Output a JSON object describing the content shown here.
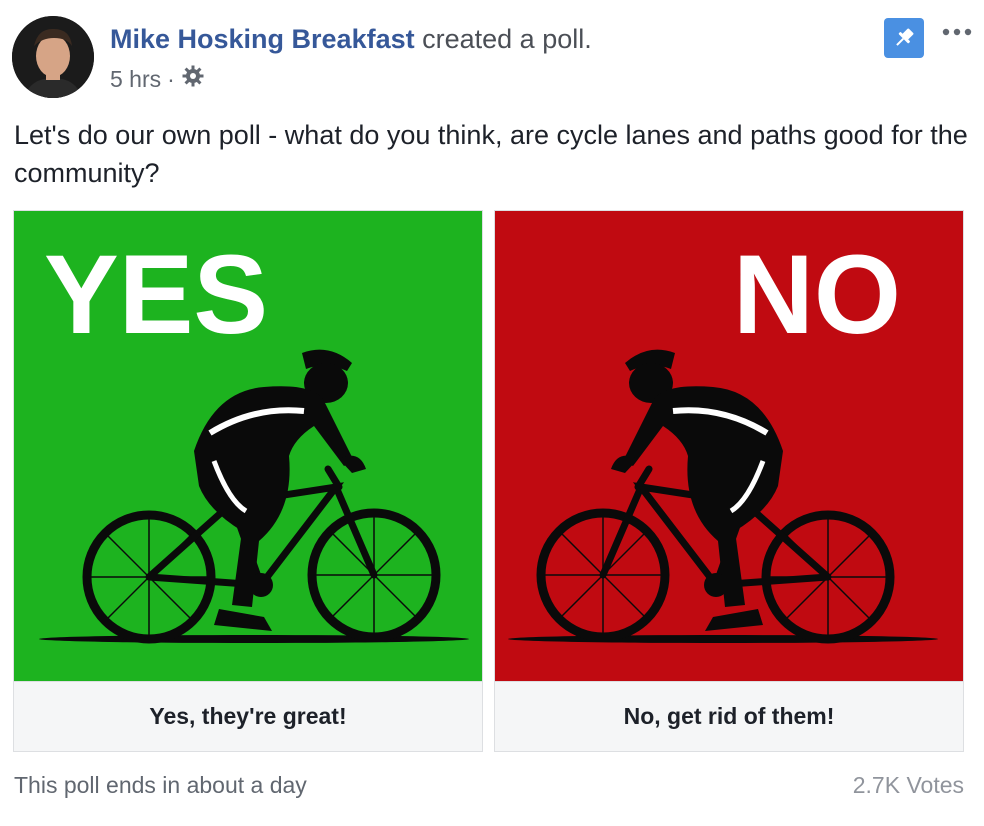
{
  "post": {
    "author": "Mike Hosking Breakfast",
    "action": "created a poll.",
    "time": "5 hrs",
    "separator": "·",
    "privacy_icon": "gear-icon",
    "text": "Let's do our own poll - what do you think, are cycle lanes and paths good for the community?"
  },
  "poll": {
    "options": [
      {
        "image_text": "YES",
        "label": "Yes, they're great!",
        "color": "#1db31f",
        "icon": "cyclist-icon"
      },
      {
        "image_text": "NO",
        "label": "No, get rid of them!",
        "color": "#c00a11",
        "icon": "cyclist-icon"
      }
    ],
    "ends": "This poll ends in about a day",
    "votes": "2.7K Votes"
  },
  "colors": {
    "author_link": "#365899",
    "pin": "#4a90e2"
  }
}
